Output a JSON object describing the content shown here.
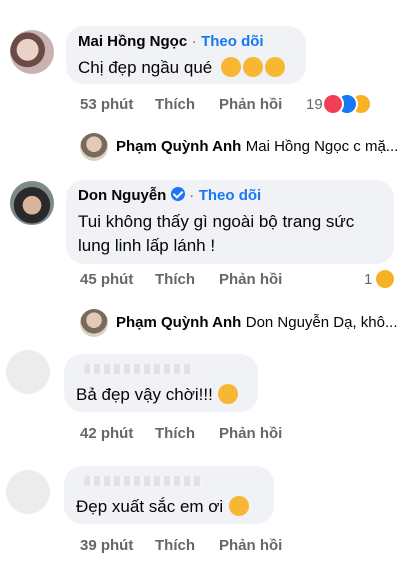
{
  "comments": [
    {
      "author": "Mai Hồng Ngọc",
      "separator": "·",
      "follow_label": "Theo dõi",
      "text": "Chị đẹp ngầu qué",
      "time": "53 phút",
      "like_label": "Thích",
      "reply_label": "Phản hồi",
      "reaction_count": "19",
      "reactions": [
        "heart-reaction-icon",
        "like-reaction-icon",
        "haha-reaction-icon"
      ],
      "reply": {
        "author": "Phạm Quỳnh Anh",
        "preview": "Mai Hồng Ngọc c mặ..."
      }
    },
    {
      "author": "Don Nguyễn",
      "verified": true,
      "separator": "·",
      "follow_label": "Theo dõi",
      "text_line1": "Tui không thấy gì ngoài bộ trang sức",
      "text_line2": "lung linh lấp lánh !",
      "time": "45 phút",
      "like_label": "Thích",
      "reply_label": "Phản hồi",
      "reaction_count": "1",
      "reactions": [
        "haha-reaction-icon"
      ],
      "reply": {
        "author": "Phạm Quỳnh Anh",
        "preview": "Don Nguyễn Dạ, khô..."
      }
    },
    {
      "text": "Bả đẹp vậy chời!!!",
      "time": "42 phút",
      "like_label": "Thích",
      "reply_label": "Phản hồi"
    },
    {
      "text": "Đẹp xuất sắc em ơi",
      "time": "39 phút",
      "like_label": "Thích",
      "reply_label": "Phản hồi"
    }
  ],
  "colors": {
    "bubble": "#f0f2f5",
    "accent": "#1877f2",
    "meta": "#65676b"
  }
}
